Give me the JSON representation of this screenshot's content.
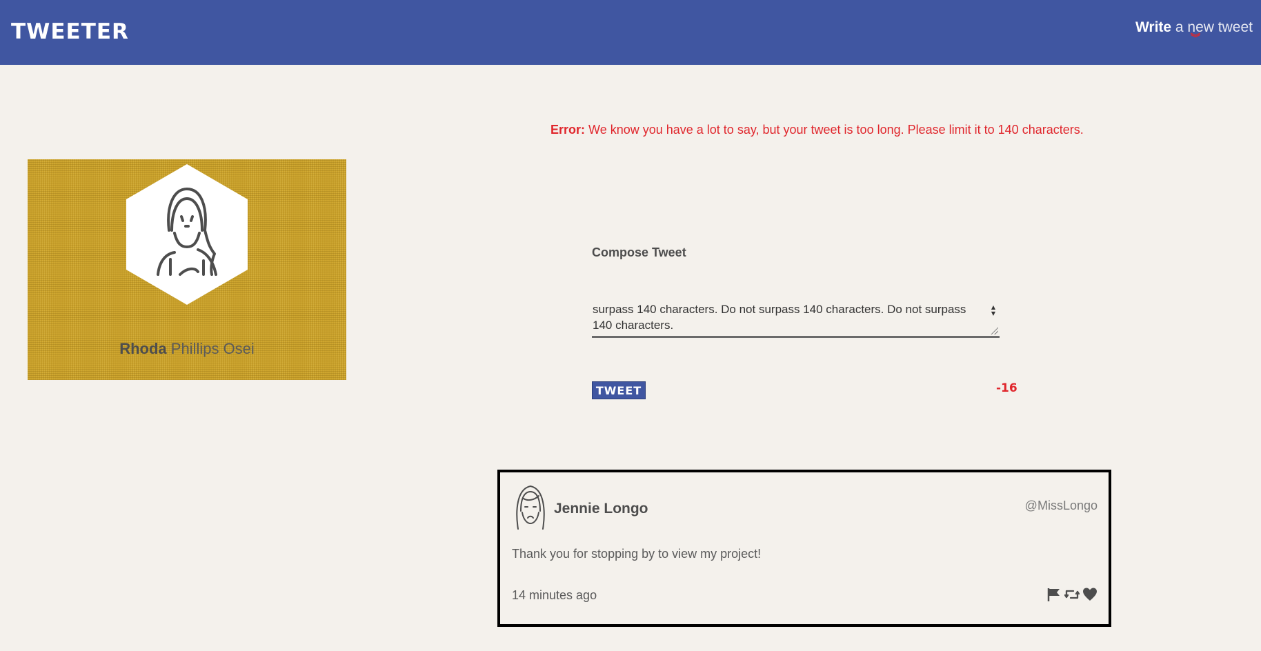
{
  "nav": {
    "brand": "TWEETER",
    "compose_bold": "Write",
    "compose_light": "a new tweet",
    "chevron_icon": "double-chevron-down-icon",
    "colors": {
      "bar": "#4056a1",
      "accent": "#e0262c"
    }
  },
  "error": {
    "label": "Error:",
    "message": "We know you have a lot to say, but your tweet is too long. Please limit it to 140 characters."
  },
  "profile": {
    "first_name": "Rhoda",
    "rest_name": "Phillips Osei",
    "avatar_icon": "user-avatar-icon",
    "background": "#c9a02a"
  },
  "compose": {
    "label": "Compose Tweet",
    "text": "surpass 140 characters. Do not surpass 140 characters. Do not surpass 140 characters.",
    "button_label": "TWEET",
    "counter": "-16"
  },
  "tweet": {
    "name": "Jennie Longo",
    "handle": "@MissLongo",
    "content": "Thank you for stopping by to view my project!",
    "timestamp": "14 minutes ago",
    "actions": [
      "flag-icon",
      "retweet-icon",
      "heart-icon"
    ]
  }
}
